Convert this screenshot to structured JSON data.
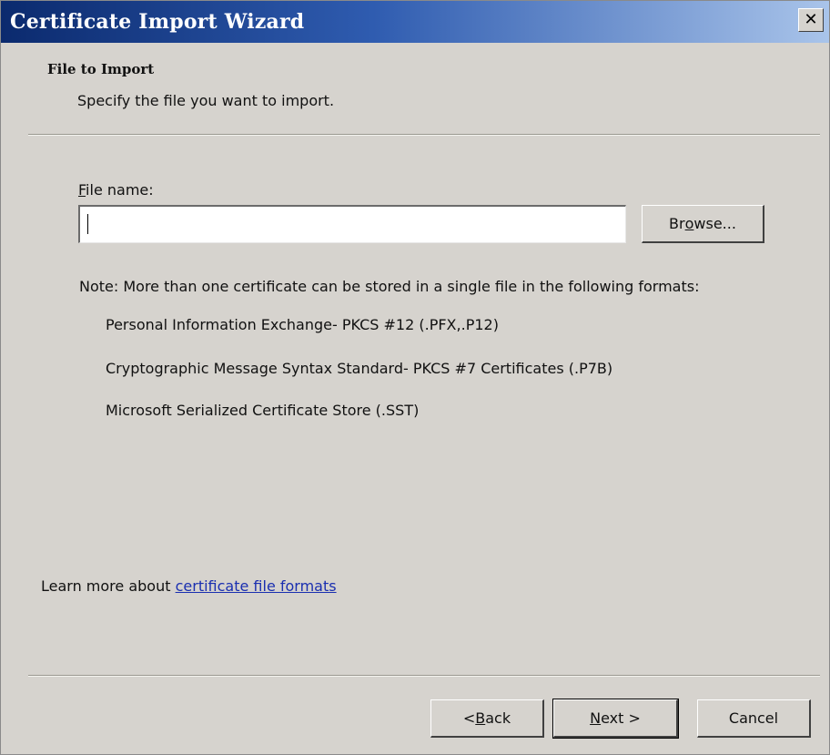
{
  "window": {
    "title": "Certificate Import Wizard",
    "close_label": "✕",
    "colors": {
      "titlebar_start": "#0b2a6e",
      "titlebar_end": "#a9c4ea",
      "dialog_bg": "#d6d3ce",
      "link": "#1a2fb0"
    }
  },
  "header": {
    "title": "File to Import",
    "subtitle": "Specify the file you want to import."
  },
  "file_name": {
    "label_accel": "F",
    "label_rest": "ile name:",
    "value": "",
    "browse_accel_pre": "Br",
    "browse_accel": "o",
    "browse_rest": "wse..."
  },
  "note": {
    "text": "Note:  More than one certificate can be stored in a single file in the following formats:",
    "formats": [
      "Personal Information Exchange- PKCS #12 (.PFX,.P12)",
      "Cryptographic Message Syntax Standard- PKCS #7 Certificates (.P7B)",
      "Microsoft Serialized Certificate Store (.SST)"
    ]
  },
  "learn_more": {
    "prefix": "Learn more about ",
    "link_text": "certificate file formats"
  },
  "footer": {
    "back_pre": "< ",
    "back_accel": "B",
    "back_rest": "ack",
    "next_accel": "N",
    "next_rest": "ext >",
    "cancel": "Cancel"
  }
}
